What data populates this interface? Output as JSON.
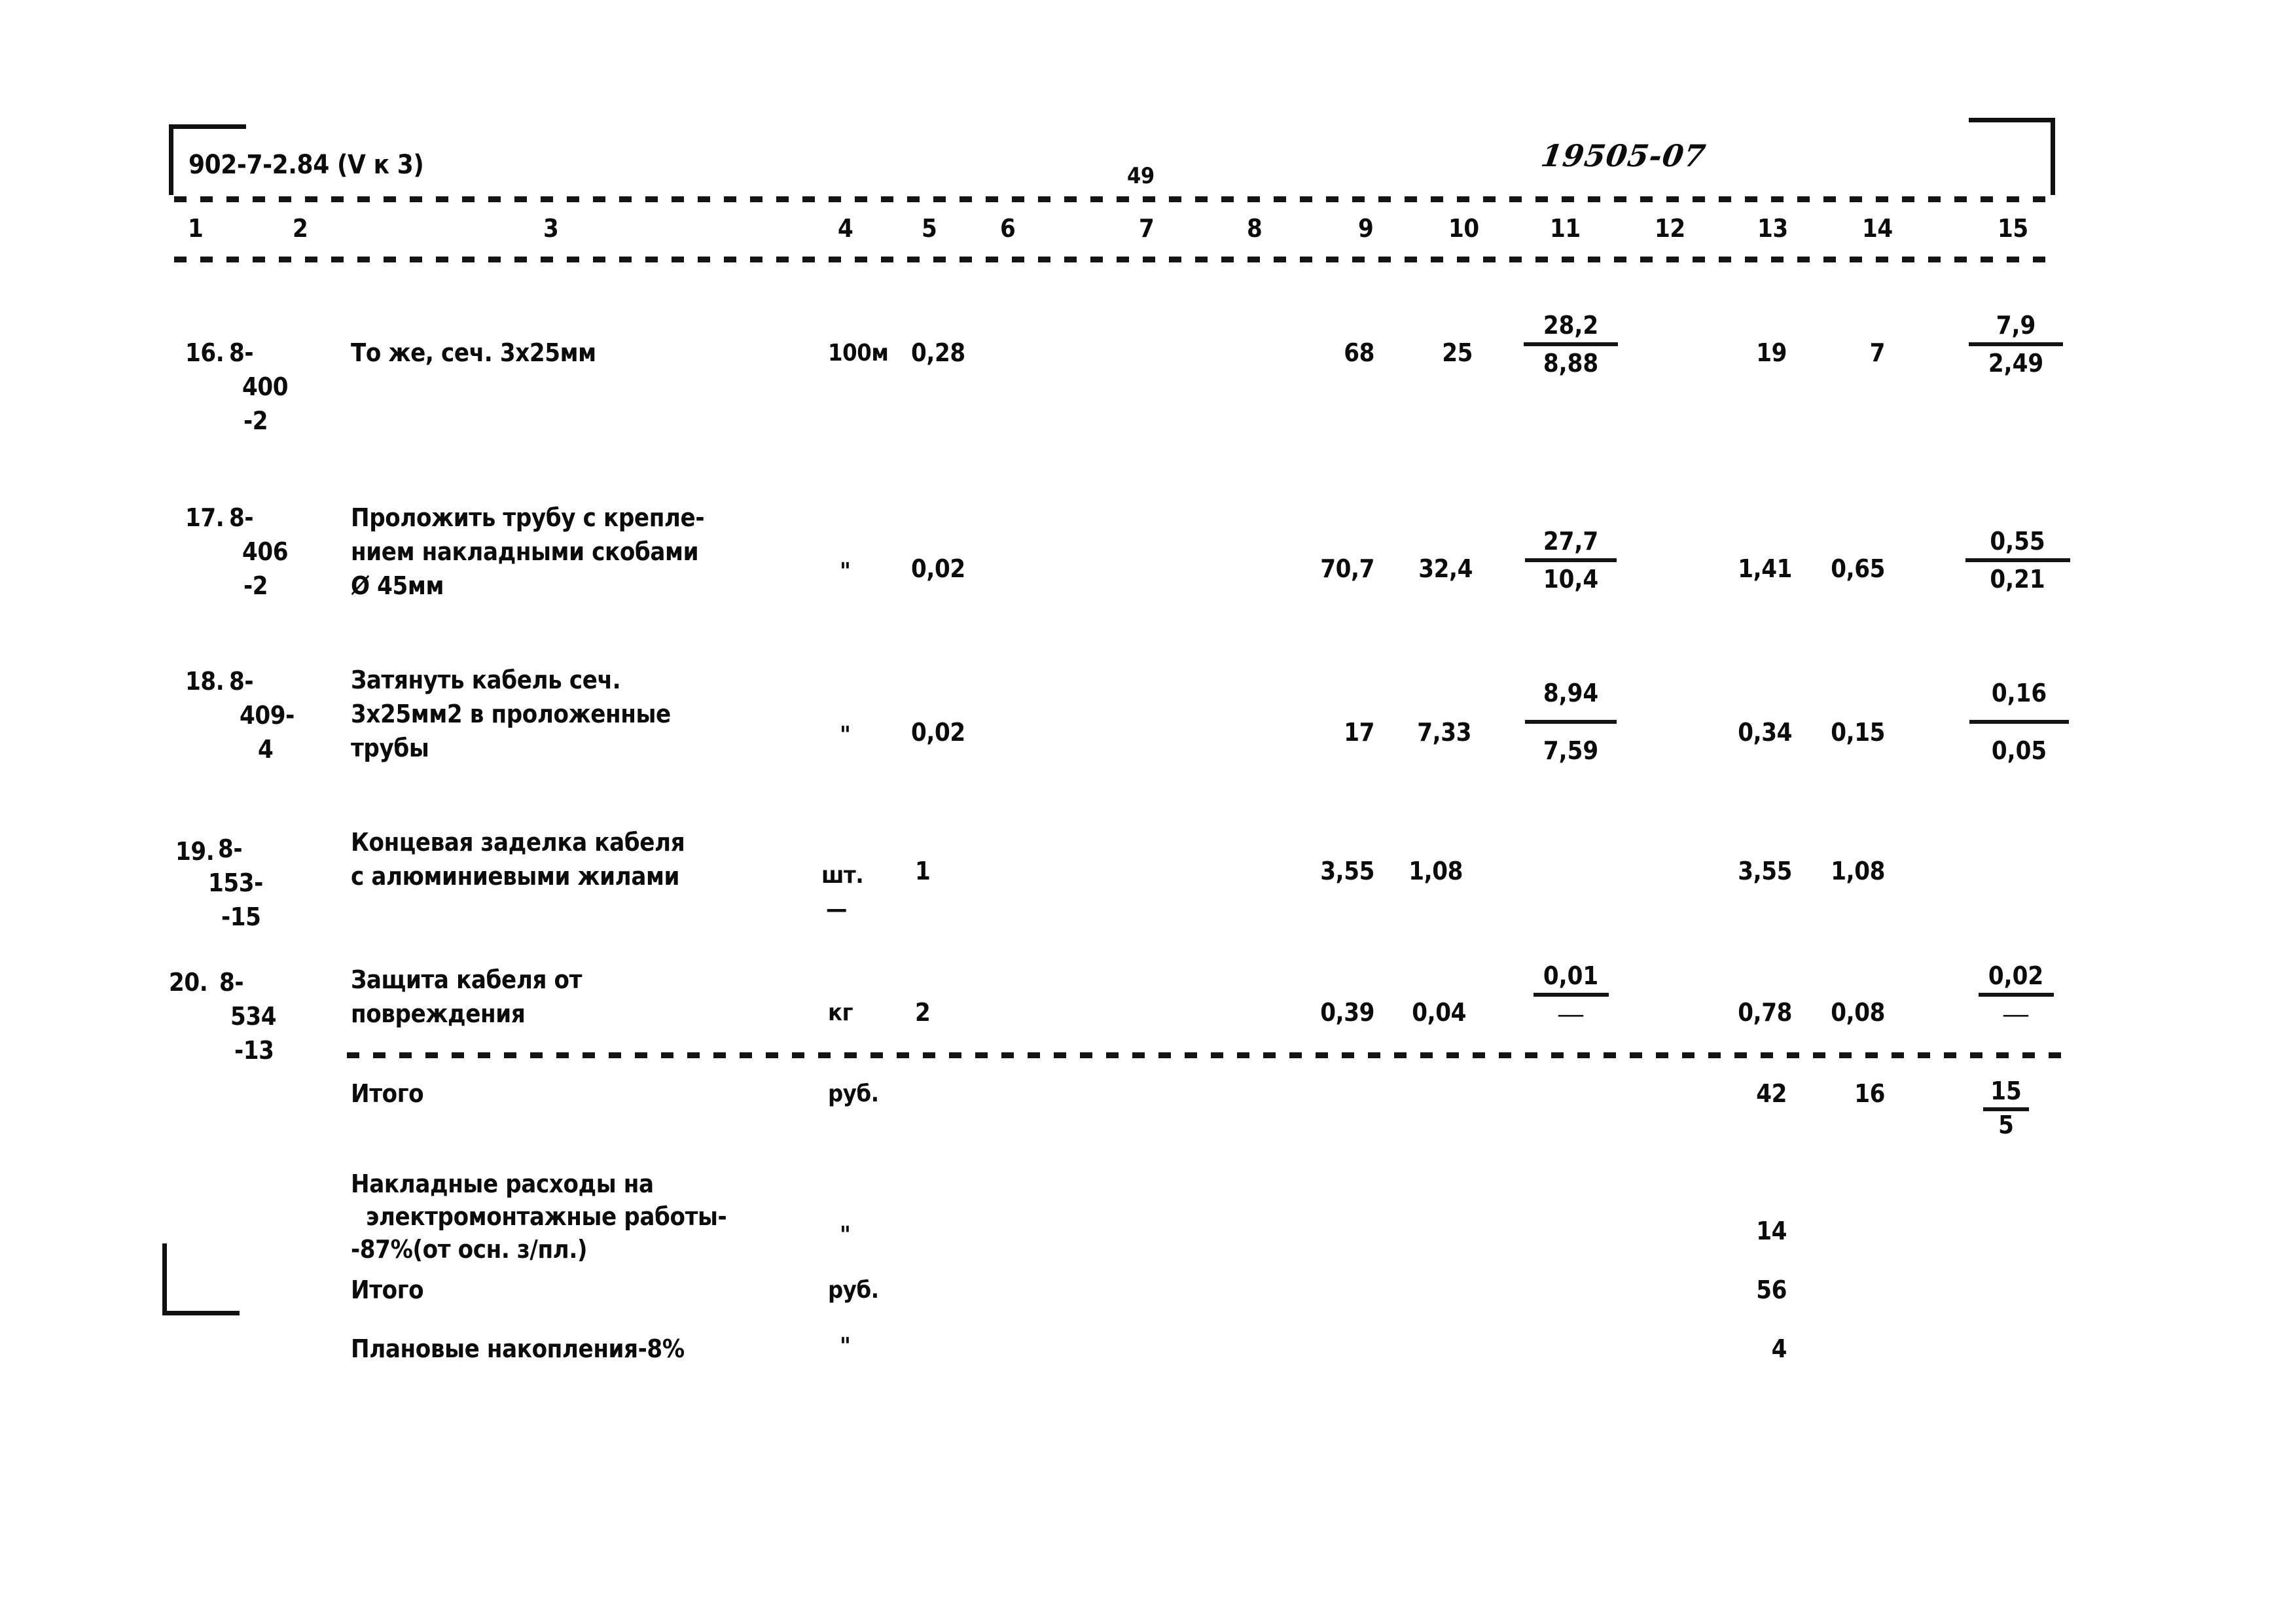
{
  "document": {
    "header_left": "902-7-2.84 (V к 3)",
    "page_number": "49",
    "handwritten_code": "19505-07"
  },
  "table": {
    "column_numbers": [
      "1",
      "2",
      "3",
      "4",
      "5",
      "6",
      "7",
      "8",
      "9",
      "10",
      "11",
      "12",
      "13",
      "14",
      "15"
    ],
    "rows": [
      {
        "index": "16.",
        "code_line1": "8-",
        "code_line2": "400",
        "code_line3": "-2",
        "description": [
          "То же, сеч. 3х25мм"
        ],
        "unit": "100м",
        "c5": "0,28",
        "c6": "",
        "c7": "",
        "c8": "",
        "c9": "68",
        "c10": "25",
        "c11_top": "28,2",
        "c11_bot": "8,88",
        "c12": "",
        "c13": "19",
        "c14": "7",
        "c15_top": "7,9",
        "c15_bot": "2,49"
      },
      {
        "index": "17.",
        "code_line1": "8-",
        "code_line2": "406",
        "code_line3": "-2",
        "description": [
          "Проложить трубу с крепле-",
          "нием накладными скобами",
          "Ø 45мм"
        ],
        "unit": "\"",
        "c5": "0,02",
        "c6": "",
        "c7": "",
        "c8": "",
        "c9": "70,7",
        "c10": "32,4",
        "c11_top": "27,7",
        "c11_bot": "10,4",
        "c12": "",
        "c13": "1,41",
        "c14": "0,65",
        "c15_top": "0,55",
        "c15_bot": "0,21"
      },
      {
        "index": "18.",
        "code_line1": "8-",
        "code_line2": "409-",
        "code_line3": "4",
        "description": [
          "Затянуть кабель сеч.",
          "3х25мм2 в проложенные",
          "трубы"
        ],
        "unit": "\"",
        "c5": "0,02",
        "c6": "",
        "c7": "",
        "c8": "",
        "c9": "17",
        "c10": "7,33",
        "c11_top": "8,94",
        "c11_bot": "7,59",
        "c12": "",
        "c13": "0,34",
        "c14": "0,15",
        "c15_top": "0,16",
        "c15_bot": "0,05"
      },
      {
        "index": "19.",
        "code_line1": "8-",
        "code_line2": "153-",
        "code_line3": "-15",
        "description": [
          "Концевая заделка кабеля",
          "с алюминиевыми жилами"
        ],
        "unit": "шт.",
        "unit_sub": "—",
        "c5": "1",
        "c6": "",
        "c7": "",
        "c8": "",
        "c9": "3,55",
        "c10": "1,08",
        "c11_top": "",
        "c11_bot": "",
        "c12": "",
        "c13": "3,55",
        "c14": "1,08",
        "c15_top": "",
        "c15_bot": ""
      },
      {
        "index": "20.",
        "code_line1": "8-",
        "code_line2": "534",
        "code_line3": "-13",
        "description": [
          "Защита кабеля от",
          "повреждения"
        ],
        "unit": "кг",
        "c5": "2",
        "c6": "",
        "c7": "",
        "c8": "",
        "c9": "0,39",
        "c10": "0,04",
        "c11_top": "0,01",
        "c11_bot": "—",
        "c12": "",
        "c13": "0,78",
        "c14": "0,08",
        "c15_top": "0,02",
        "c15_bot": "—"
      }
    ],
    "summary": [
      {
        "label": [
          "Итого"
        ],
        "unit": "руб.",
        "c13": "42",
        "c14": "16",
        "c15_top": "15",
        "c15_bot": "5"
      },
      {
        "label": [
          "Накладные расходы на",
          "  электромонтажные работы-",
          "-87%(от осн. з/пл.)"
        ],
        "unit": "\"",
        "c13": "14",
        "c14": "",
        "c15_top": "",
        "c15_bot": ""
      },
      {
        "label": [
          "Итого"
        ],
        "unit": "руб.",
        "c13": "56",
        "c14": "",
        "c15_top": "",
        "c15_bot": ""
      },
      {
        "label": [
          "Плановые накопления-8%"
        ],
        "unit": "\"",
        "c13": "4",
        "c14": "",
        "c15_top": "",
        "c15_bot": ""
      }
    ]
  }
}
